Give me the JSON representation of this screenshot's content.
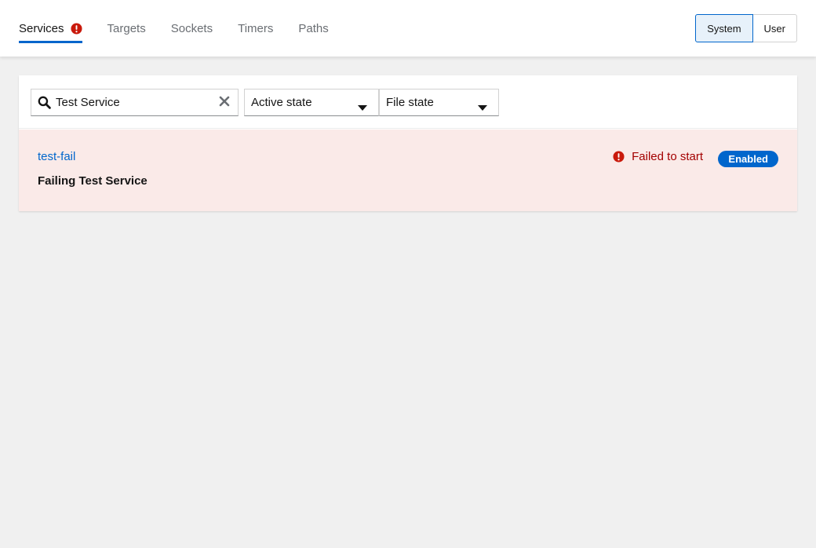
{
  "tabs": [
    {
      "label": "Services",
      "active": true,
      "alert": true
    },
    {
      "label": "Targets"
    },
    {
      "label": "Sockets"
    },
    {
      "label": "Timers"
    },
    {
      "label": "Paths"
    }
  ],
  "scope_toggle": {
    "system_label": "System",
    "user_label": "User",
    "selected": "System"
  },
  "filters": {
    "search_value": "Test Service",
    "active_state_label": "Active state",
    "file_state_label": "File state"
  },
  "units": [
    {
      "name": "test-fail",
      "description": "Failing Test Service",
      "status": "Failed to start",
      "file_state": "Enabled"
    }
  ],
  "colors": {
    "accent": "#0066cc",
    "danger": "#c9190b",
    "danger_text": "#a30000",
    "row_failed_bg": "#faeae8"
  },
  "icons": {
    "alert": "exclamation-circle-icon",
    "search": "search-icon",
    "clear": "times-icon",
    "caret": "caret-down-icon"
  }
}
